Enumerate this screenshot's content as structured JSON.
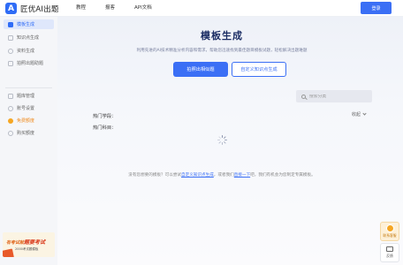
{
  "header": {
    "logo_mark": "A",
    "logo_text": "匠优AI出题",
    "nav": [
      {
        "label": "教程"
      },
      {
        "label": "报客"
      },
      {
        "label": "API文档"
      }
    ],
    "login_label": "登录"
  },
  "sidebar": {
    "items": [
      {
        "label": "模板生成",
        "active": true,
        "icon": "template-icon"
      },
      {
        "label": "知识点生成",
        "icon": "knowledge-icon"
      },
      {
        "label": "资料生成",
        "icon": "document-icon"
      },
      {
        "label": "拍照出题助题",
        "icon": "camera-icon"
      },
      {
        "label": "题库管理",
        "icon": "question-bank-icon"
      },
      {
        "label": "账号设置",
        "icon": "account-icon"
      },
      {
        "label": "免费额度",
        "icon": "gift-icon"
      },
      {
        "label": "购买额度",
        "icon": "purchase-icon"
      }
    ],
    "promo": {
      "title_prefix": "有考试就",
      "title_highlight": "题要考试",
      "subtitle": "2000考试题模板"
    }
  },
  "main": {
    "title": "模板生成",
    "description": "利用先进的AI技术精准分析内容和需求，帮助您迅速找到最佳题目模板试题，轻松解决出题难题",
    "primary_button": "拍照出相似题",
    "secondary_button": "自定义知识点生成",
    "search_placeholder": "搜索分类",
    "filter_hot_subject": "热门学段：",
    "filter_hot_course": "热门科目：",
    "collapse_label": "收起",
    "footer_prefix": "没有您想要的模板？可以尝试",
    "footer_link1": "自定义知识点生成",
    "footer_middle": "，或者我们",
    "footer_link2": "直接一下",
    "footer_suffix": "吧，我们有机会为您制定专属模板。"
  },
  "float": {
    "service_label": "联系客服",
    "feedback_label": "反馈"
  },
  "colors": {
    "accent": "#3b6ff5",
    "title": "#1b2d64",
    "promo": "#e0661c"
  }
}
